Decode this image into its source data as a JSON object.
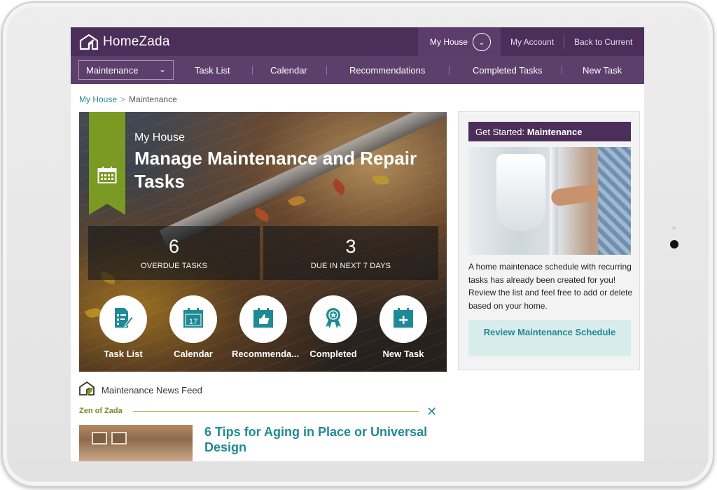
{
  "header": {
    "brand": "HomeZada",
    "house_button": "My House",
    "account_link": "My Account",
    "back_link": "Back to Current"
  },
  "subnav": {
    "select_value": "Maintenance",
    "items": [
      "Task List",
      "Calendar",
      "Recommendations",
      "Completed Tasks",
      "New Task"
    ]
  },
  "breadcrumb": {
    "home": "My House",
    "separator": ">",
    "current": "Maintenance"
  },
  "hero": {
    "kicker": "My House",
    "title": "Manage Maintenance and Repair Tasks",
    "stats": [
      {
        "value": "6",
        "label": "OVERDUE TASKS"
      },
      {
        "value": "3",
        "label": "DUE IN NEXT 7 DAYS"
      }
    ],
    "actions": [
      {
        "label": "Task List",
        "icon": "task-list-icon"
      },
      {
        "label": "Calendar",
        "icon": "calendar-icon",
        "day": "17"
      },
      {
        "label": "Recommenda...",
        "icon": "thumbs-up-calendar-icon"
      },
      {
        "label": "Completed",
        "icon": "award-ribbon-icon"
      },
      {
        "label": "New Task",
        "icon": "add-calendar-icon"
      }
    ]
  },
  "news": {
    "title": "Maintenance News Feed",
    "category": "Zen of Zada",
    "article_title": "6 Tips for Aging in Place or Universal Design"
  },
  "panel": {
    "heading_prefix": "Get Started: ",
    "heading_bold": "Maintenance",
    "body": "A home maintenace schedule with recurring tasks has already been created for you! Review the list and feel free to add or delete based on your home.",
    "button": "Review Maintenance Schedule"
  },
  "colors": {
    "brand_purple": "#4b2f5a",
    "subnav_purple": "#5d3f6c",
    "accent_green": "#7a9a23",
    "link_teal": "#1f8a94",
    "button_bg": "#d9ecec"
  }
}
